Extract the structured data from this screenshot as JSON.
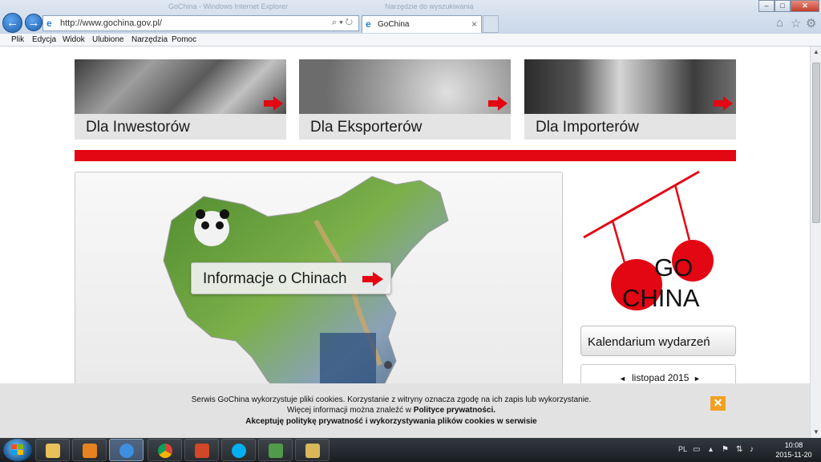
{
  "browser": {
    "title_ghost_left": "GoChina - Windows Internet Explorer",
    "title_ghost_right": "Narzędzie do wyszukiwania",
    "address": "http://www.gochina.gov.pl/",
    "tab_title": "GoChina",
    "tab_close": "×",
    "back_glyph": "←",
    "forward_glyph": "→",
    "window_buttons": {
      "minimize": "–",
      "maximize": "□",
      "close": "✕"
    },
    "toolbar_icons": [
      "home-icon",
      "favorites-star-icon",
      "settings-gear-icon"
    ],
    "menu": [
      "Plik",
      "Edycja",
      "Widok",
      "Ulubione",
      "Narzędzia",
      "Pomoc"
    ]
  },
  "page": {
    "banners": [
      {
        "label": "Dla Inwestorów"
      },
      {
        "label": "Dla Eksporterów"
      },
      {
        "label": "Dla Importerów"
      }
    ],
    "accent_color": "#e30613",
    "info_label": "Informacje o Chinach",
    "logo": {
      "top": "GO",
      "bottom": "CHINA"
    },
    "calendar": {
      "title": "Kalendarium wydarzeń",
      "month": "listopad 2015",
      "prev_glyph": "◄",
      "next_glyph": "►"
    },
    "cookie": {
      "line1": "Serwis GoChina wykorzystuje pliki cookies. Korzystanie z witryny oznacza zgodę na ich zapis lub wykorzystanie.",
      "line2_prefix": "Więcej informacji można znaleźć w ",
      "line2_link": "Polityce prywatności.",
      "line3": "Akceptuję politykę prywatność i wykorzystywania plików cookies w serwisie",
      "close_glyph": "✕",
      "close_color": "#f2a024"
    }
  },
  "taskbar": {
    "apps": [
      "file-explorer",
      "media-player",
      "internet-explorer",
      "chrome",
      "presentation-app",
      "skype",
      "network-users",
      "folder-window"
    ],
    "tray": {
      "language": "PL",
      "time": "10:08",
      "date": "2015-11-20"
    }
  }
}
